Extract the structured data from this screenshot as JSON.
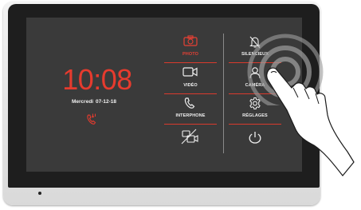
{
  "clock": {
    "time": "10:08",
    "day": "Mercredi",
    "date": "07-12-18"
  },
  "menu": {
    "photo": "PHOTO",
    "video": "VIDÉO",
    "interphone": "INTERPHONE",
    "silencieux": "SILENCIEUX",
    "camera": "CAMÉRA",
    "reglages": "RÉGLAGES"
  },
  "colors": {
    "accent": "#e63b2e",
    "screen": "#3a3a3a",
    "bezel": "#1e1e1e"
  },
  "icons": {
    "photo": "camera-icon",
    "video": "video-camera-icon",
    "interphone": "phone-icon",
    "video_off": "video-off-icon",
    "silencieux": "bell-off-icon",
    "camera": "person-icon",
    "reglages": "gear-icon",
    "power": "power-icon",
    "missed_call": "missed-call-icon"
  }
}
